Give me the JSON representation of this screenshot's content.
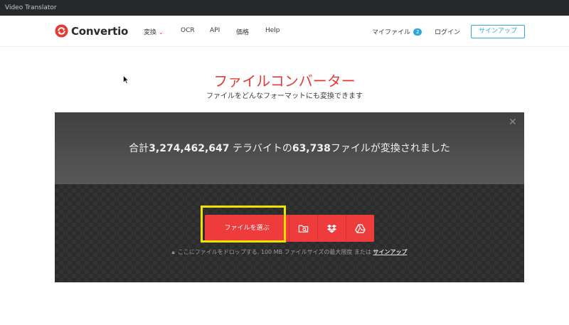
{
  "window": {
    "title": "Video Translator"
  },
  "brand": {
    "name": "Convertio",
    "accent": "#e53935"
  },
  "nav": {
    "convert": "変換",
    "ocr": "OCR",
    "api": "API",
    "pricing": "価格",
    "help": "Help",
    "my_files": "マイファイル",
    "my_files_count": "2",
    "login": "ログイン",
    "signup": "サインアップ"
  },
  "hero": {
    "title": "ファイルコンバーター",
    "subtitle": "ファイルをどんなフォーマットにも変換できます"
  },
  "panel": {
    "stats_prefix": "合計",
    "stats_terabytes": "3,274,462,647",
    "stats_mid": " テラバイトの",
    "stats_files": "63,738",
    "stats_suffix": "ファイルが変換されました",
    "choose_files": "ファイルを選ぶ",
    "drop_note": "ここにファイルをドロップする. 100 MB ファイルサイズの最大限度 または",
    "drop_note_link": "サインアップ"
  },
  "icons": {
    "logo": "convertio-logo-icon",
    "local": "folder-search-icon",
    "dropbox": "dropbox-icon",
    "gdrive": "google-drive-icon",
    "close": "close-icon",
    "lock": "lock-icon"
  }
}
